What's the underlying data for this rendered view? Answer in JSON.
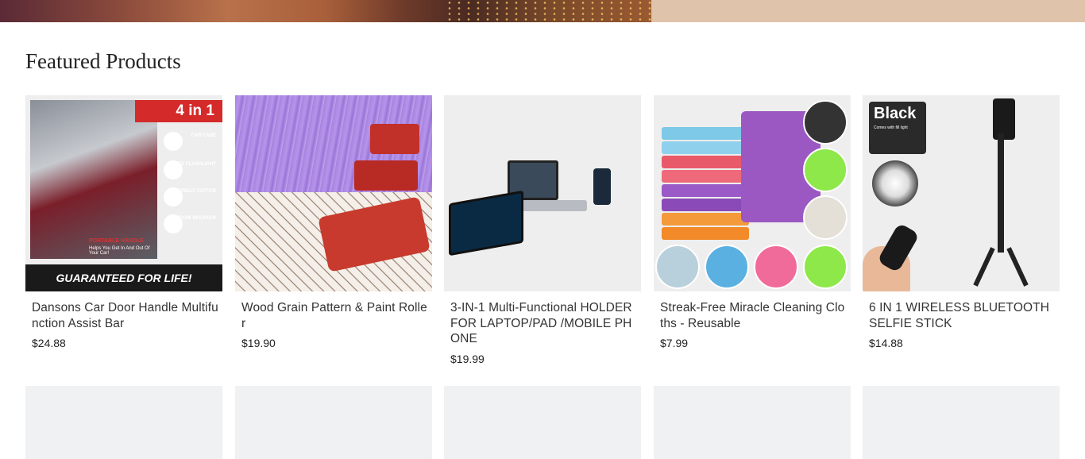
{
  "section": {
    "title": "Featured Products"
  },
  "products": [
    {
      "title": "Dansons Car Door Handle Multifunction Assist Bar",
      "price": "$24.88",
      "image": {
        "badge": "4 in 1",
        "features": [
          "CAR CANE",
          "LED FLASHLIGHT",
          "SEATBELT CUTTER",
          "WINDOW BREAKER"
        ],
        "handle_text": "PORTABLE HANDLE",
        "tagline": "Helps You Get In And Out Of Your Car!",
        "footer": "GUARANTEED FOR LIFE!"
      }
    },
    {
      "title": "Wood Grain Pattern & Paint Roller",
      "price": "$19.90"
    },
    {
      "title": "3-IN-1 Multi-Functional HOLDER FOR LAPTOP/PAD /MOBILE PHONE",
      "price": "$19.99"
    },
    {
      "title": "Streak-Free Miracle Cleaning Cloths - Reusable",
      "price": "$7.99"
    },
    {
      "title": "6 IN 1 WIRELESS BLUETOOTH SELFIE STICK",
      "price": "$14.88",
      "image": {
        "badge": "Black",
        "sub": "Comes with fill light"
      }
    }
  ],
  "colors": {
    "accent_red": "#d42a2a",
    "placeholder": "#f0f1f3",
    "hero_right": "#dfc3ab"
  }
}
